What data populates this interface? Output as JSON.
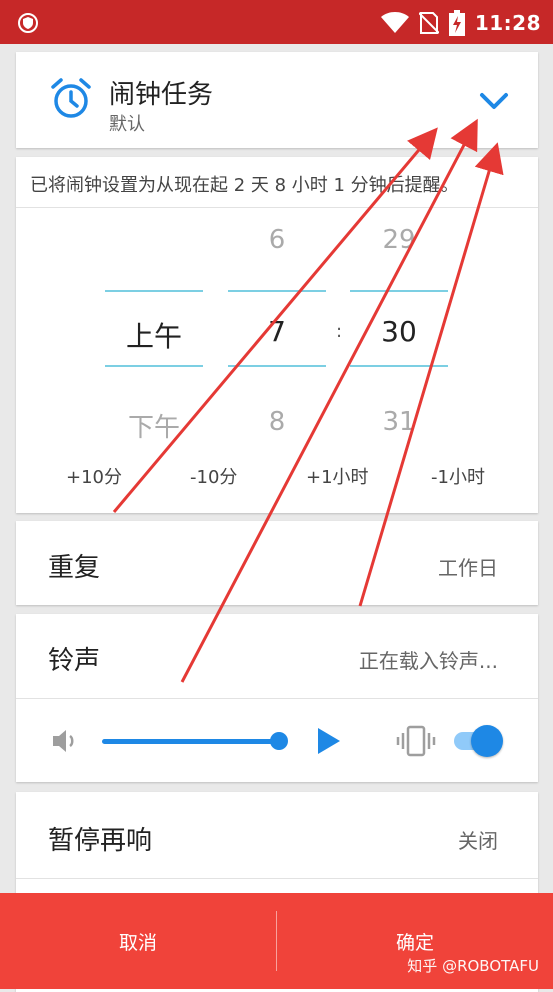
{
  "status": {
    "time": "11:28"
  },
  "header": {
    "title": "闹钟任务",
    "subtitle": "默认"
  },
  "picker": {
    "info": "已将闹钟设置为从现在起 2 天 8 小时 1 分钟后提醒。",
    "ampm": {
      "selected": "上午",
      "next": "下午"
    },
    "hour": {
      "prev": "6",
      "selected": "7",
      "next": "8"
    },
    "minute": {
      "prev": "29",
      "selected": "30",
      "next": "31"
    },
    "separator": ":",
    "quick": [
      "+10分",
      "-10分",
      "+1小时",
      "-1小时"
    ]
  },
  "repeat": {
    "label": "重复",
    "value": "工作日"
  },
  "ringtone": {
    "label": "铃声",
    "value": "正在载入铃声...",
    "volume": 1.0,
    "vibrate": true
  },
  "snooze": {
    "label": "暂停再响",
    "value": "关闭"
  },
  "footer": {
    "cancel": "取消",
    "ok": "确定",
    "watermark": "知乎 @ROBOTAFU"
  },
  "colors": {
    "accent": "#1e88e5",
    "statusbar": "#c62828",
    "footer": "#f0433a",
    "annotation": "#e53935"
  }
}
